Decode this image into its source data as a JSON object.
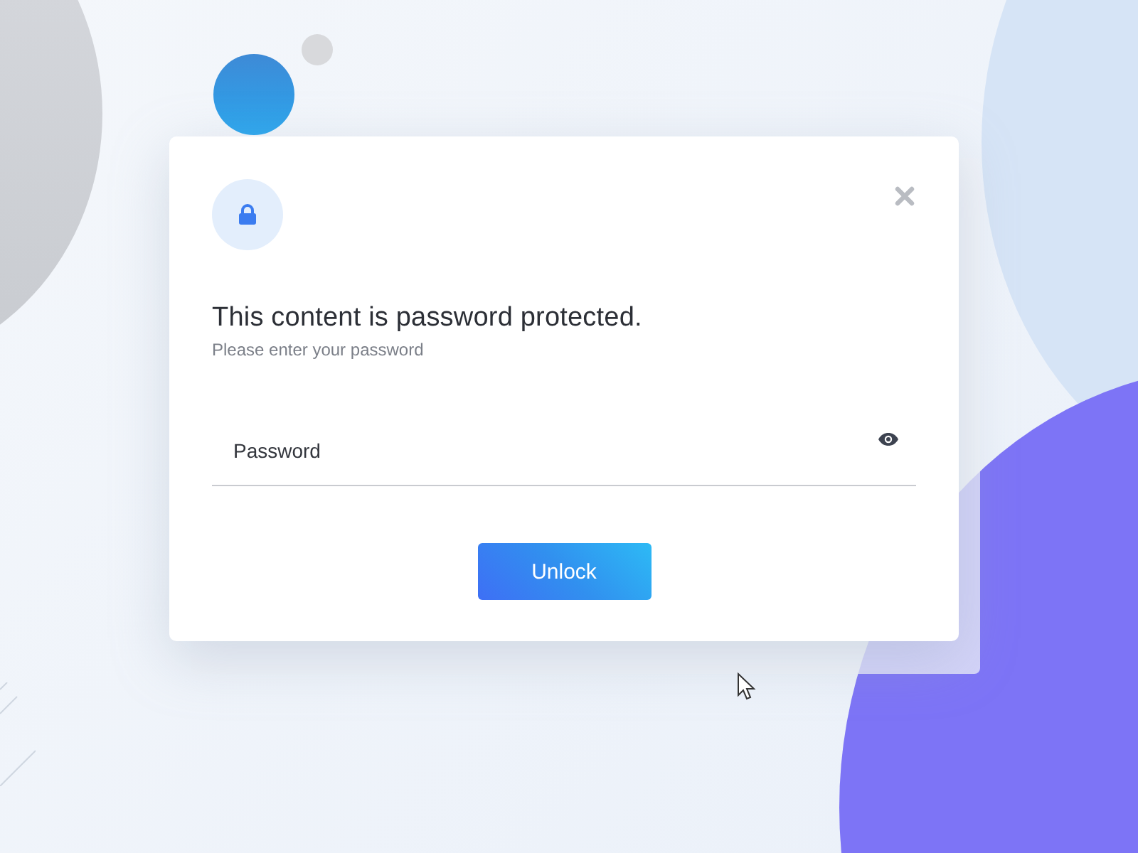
{
  "dialog": {
    "title": "This content is password protected.",
    "subtitle": "Please enter your password",
    "password_field": {
      "placeholder": "Password"
    },
    "button": "Unlock"
  }
}
